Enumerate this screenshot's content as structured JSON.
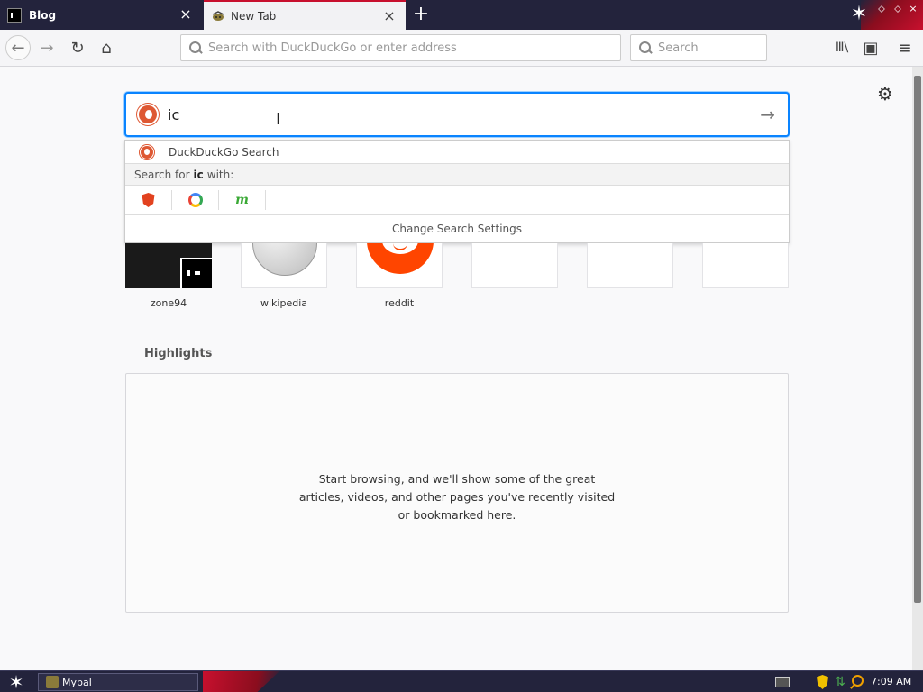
{
  "tabs": [
    {
      "label": "Blog",
      "close_glyph": "×",
      "icon": "blog-favicon",
      "active": false
    },
    {
      "label": "New Tab",
      "close_glyph": "×",
      "icon": "mypal-favicon",
      "active": true
    }
  ],
  "tabstrip": {
    "new_tab_glyph": "+",
    "star_glyph": "✶",
    "win_glyphs": [
      "⬦",
      "⬦",
      "×"
    ]
  },
  "navbar": {
    "back_glyph": "←",
    "forward_glyph": "→",
    "reload_glyph": "↻",
    "home_glyph": "⌂",
    "url_placeholder": "Search with DuckDuckGo or enter address",
    "search_placeholder": "Search",
    "library_glyph": "Ⅲ\\",
    "sidebar_glyph": "▣",
    "menu_glyph": "≡"
  },
  "newtab": {
    "gear_glyph": "⚙",
    "search_value": "ic",
    "go_glyph": "→",
    "cursor_glyph": "I",
    "dropdown": {
      "engine_row_label": "DuckDuckGo Search",
      "search_for_prefix": "Search for",
      "search_for_term": "ic",
      "search_for_suffix": "with:",
      "alt_engines": [
        "brave-icon",
        "qwant-icon",
        "mojeek-icon"
      ],
      "mojeek_glyph": "m",
      "footer": "Change Search Settings"
    },
    "top_sites": [
      {
        "label": "zone94"
      },
      {
        "label": "wikipedia"
      },
      {
        "label": "reddit"
      },
      {
        "label": ""
      },
      {
        "label": ""
      },
      {
        "label": ""
      }
    ],
    "highlights": {
      "title": "Highlights",
      "empty_message": "Start browsing, and we'll show some of the great articles, videos, and other pages you've recently visited or bookmarked here."
    }
  },
  "taskbar": {
    "start_glyph": "✶",
    "task_label": "Mypal",
    "net_glyph": "⇅",
    "clock": "7:09 AM"
  },
  "colors": {
    "accent": "#0a84ff",
    "chrome_dark": "#23233c",
    "brand_red": "#c8102e",
    "duckduckgo": "#de5833",
    "reddit": "#ff4500"
  }
}
